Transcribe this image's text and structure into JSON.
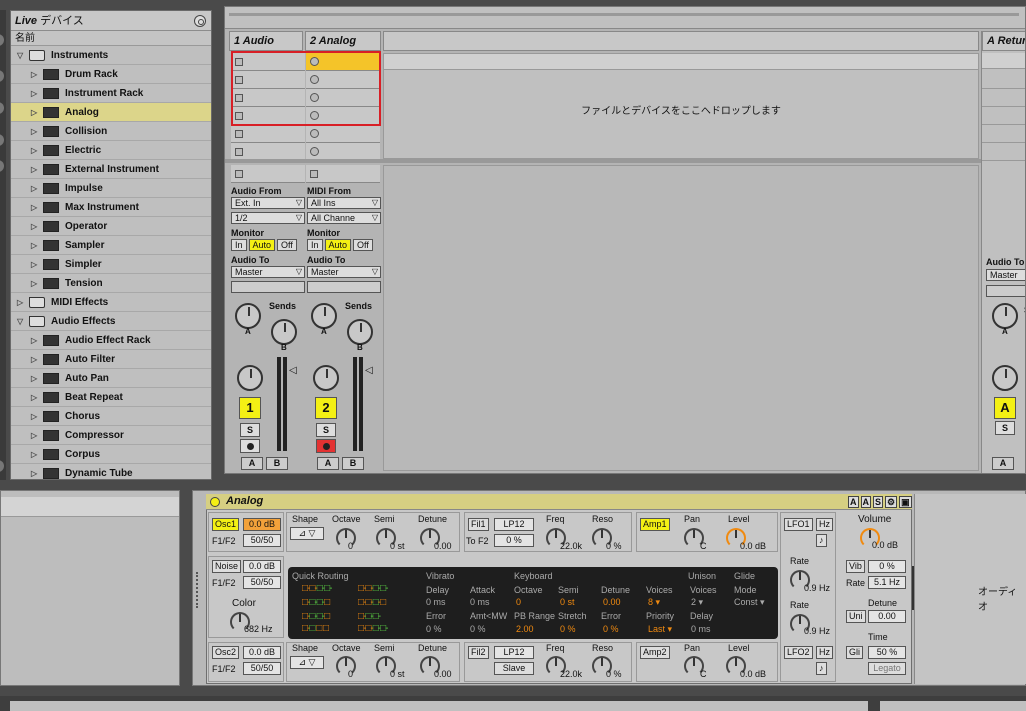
{
  "browser": {
    "title_live": "Live",
    "title_rest": " デバイス",
    "column_header": "名前",
    "items": [
      {
        "label": "Instruments",
        "type": "folder",
        "level": 0,
        "expanded": true
      },
      {
        "label": "Drum Rack",
        "type": "device",
        "level": 1
      },
      {
        "label": "Instrument Rack",
        "type": "device",
        "level": 1
      },
      {
        "label": "Analog",
        "type": "device",
        "level": 1,
        "selected": true
      },
      {
        "label": "Collision",
        "type": "device",
        "level": 1
      },
      {
        "label": "Electric",
        "type": "device",
        "level": 1
      },
      {
        "label": "External Instrument",
        "type": "device",
        "level": 1
      },
      {
        "label": "Impulse",
        "type": "device",
        "level": 1
      },
      {
        "label": "Max Instrument",
        "type": "device",
        "level": 1
      },
      {
        "label": "Operator",
        "type": "device",
        "level": 1
      },
      {
        "label": "Sampler",
        "type": "device",
        "level": 1
      },
      {
        "label": "Simpler",
        "type": "device",
        "level": 1
      },
      {
        "label": "Tension",
        "type": "device",
        "level": 1
      },
      {
        "label": "MIDI Effects",
        "type": "folder",
        "level": 0,
        "expanded": false
      },
      {
        "label": "Audio Effects",
        "type": "folder",
        "level": 0,
        "expanded": true
      },
      {
        "label": "Audio Effect Rack",
        "type": "device",
        "level": 1
      },
      {
        "label": "Auto Filter",
        "type": "device",
        "level": 1
      },
      {
        "label": "Auto Pan",
        "type": "device",
        "level": 1
      },
      {
        "label": "Beat Repeat",
        "type": "device",
        "level": 1
      },
      {
        "label": "Chorus",
        "type": "device",
        "level": 1
      },
      {
        "label": "Compressor",
        "type": "device",
        "level": 1
      },
      {
        "label": "Corpus",
        "type": "device",
        "level": 1
      },
      {
        "label": "Dynamic Tube",
        "type": "device",
        "level": 1
      }
    ]
  },
  "session": {
    "tracks": [
      {
        "name": "1 Audio",
        "io_from_label": "Audio From",
        "io_from": "Ext. In",
        "io_channel": "1/2",
        "monitor_label": "Monitor",
        "audio_to_label": "Audio To",
        "audio_to": "Master",
        "number": "1",
        "armed": false
      },
      {
        "name": "2 Analog",
        "io_from_label": "MIDI From",
        "io_from": "All Ins",
        "io_channel": "All Channe",
        "monitor_label": "Monitor",
        "audio_to_label": "Audio To",
        "audio_to": "Master",
        "number": "2",
        "armed": true
      }
    ],
    "monitor_options": [
      "In",
      "Auto",
      "Off"
    ],
    "sends_label": "Sends",
    "send_a": "A",
    "send_b": "B",
    "solo_label": "S",
    "drop_message": "ファイルとデバイスをここへドロップします",
    "return_track": {
      "name": "A Return",
      "audio_to_label": "Audio To",
      "audio_to": "Master",
      "number": "A",
      "sends_label": "S"
    }
  },
  "device": {
    "name": "Analog",
    "header_icons": [
      "A",
      "A",
      "S"
    ],
    "osc1": {
      "label": "Osc1",
      "level": "0.0 dB",
      "f1f2_label": "F1/F2",
      "f1f2": "50/50",
      "shape_label": "Shape",
      "octave_label": "Octave",
      "octave": "0",
      "semi_label": "Semi",
      "semi": "0 st",
      "detune_label": "Detune",
      "detune": "0.00"
    },
    "fil1": {
      "label": "Fil1",
      "type": "LP12",
      "freq_label": "Freq",
      "freq": "22.0k",
      "reso_label": "Reso",
      "reso": "0 %",
      "to_f2_label": "To F2",
      "to_f2": "0 %"
    },
    "amp1": {
      "label": "Amp1",
      "pan_label": "Pan",
      "pan": "C",
      "level_label": "Level",
      "level": "0.0 dB"
    },
    "lfo1": {
      "label": "LFO1",
      "hz": "Hz",
      "rate_label": "Rate",
      "rate": "0.9 Hz"
    },
    "noise": {
      "label": "Noise",
      "level": "0.0 dB",
      "f1f2_label": "F1/F2",
      "f1f2": "50/50",
      "color_label": "Color",
      "color": "682 Hz"
    },
    "quick": {
      "routing_label": "Quick Routing",
      "vibrato_label": "Vibrato",
      "keyboard_label": "Keyboard",
      "unison_label": "Unison",
      "glide_label": "Glide",
      "delay_label": "Delay",
      "delay": "0 ms",
      "error_label": "Error",
      "error": "0 %",
      "attack_label": "Attack",
      "attack": "0 ms",
      "amt_label": "Amt<MW",
      "amt": "0 %",
      "octave_label": "Octave",
      "octave": "0",
      "pb_label": "PB Range",
      "pb": "2.00",
      "semi_label": "Semi",
      "semi": "0 st",
      "stretch_label": "Stretch",
      "stretch": "0 %",
      "detune_label": "Detune",
      "detune": "0.00",
      "kerror_label": "Error",
      "kerror": "0 %",
      "voices_label": "Voices",
      "voices": "8",
      "priority_label": "Priority",
      "priority": "Last",
      "uvoices_label": "Voices",
      "uvoices": "2",
      "udelay_label": "Delay",
      "udelay": "0 ms",
      "mode_label": "Mode",
      "mode": "Const"
    },
    "lfo_rate2_label": "Rate",
    "lfo_rate2": "0.9 Hz",
    "osc2": {
      "label": "Osc2",
      "level": "0.0 dB",
      "f1f2_label": "F1/F2",
      "f1f2": "50/50",
      "shape_label": "Shape",
      "octave_label": "Octave",
      "octave": "0",
      "semi_label": "Semi",
      "semi": "0 st",
      "detune_label": "Detune",
      "detune": "0.00"
    },
    "fil2": {
      "label": "Fil2",
      "type": "LP12",
      "freq_label": "Freq",
      "freq": "22.0k",
      "reso_label": "Reso",
      "reso": "0 %",
      "slave_label": "Slave"
    },
    "amp2": {
      "label": "Amp2",
      "pan_label": "Pan",
      "pan": "C",
      "level_label": "Level",
      "level": "0.0 dB"
    },
    "lfo2": {
      "label": "LFO2",
      "hz": "Hz"
    },
    "global": {
      "volume_label": "Volume",
      "volume": "0.0 dB",
      "vib_label": "Vib",
      "vib": "0 %",
      "rate_label": "Rate",
      "rate": "5.1 Hz",
      "detune_label": "Detune",
      "uni_label": "Uni",
      "uni": "0.00",
      "time_label": "Time",
      "gli_label": "Gli",
      "gli": "50 %",
      "legato_label": "Legato"
    }
  },
  "right_panel_message": "オーディオ",
  "colors": {
    "accent_yellow": "#f4f014",
    "selection": "#dcd58a",
    "record_red": "#e33232",
    "knob_orange": "#f08a10"
  }
}
